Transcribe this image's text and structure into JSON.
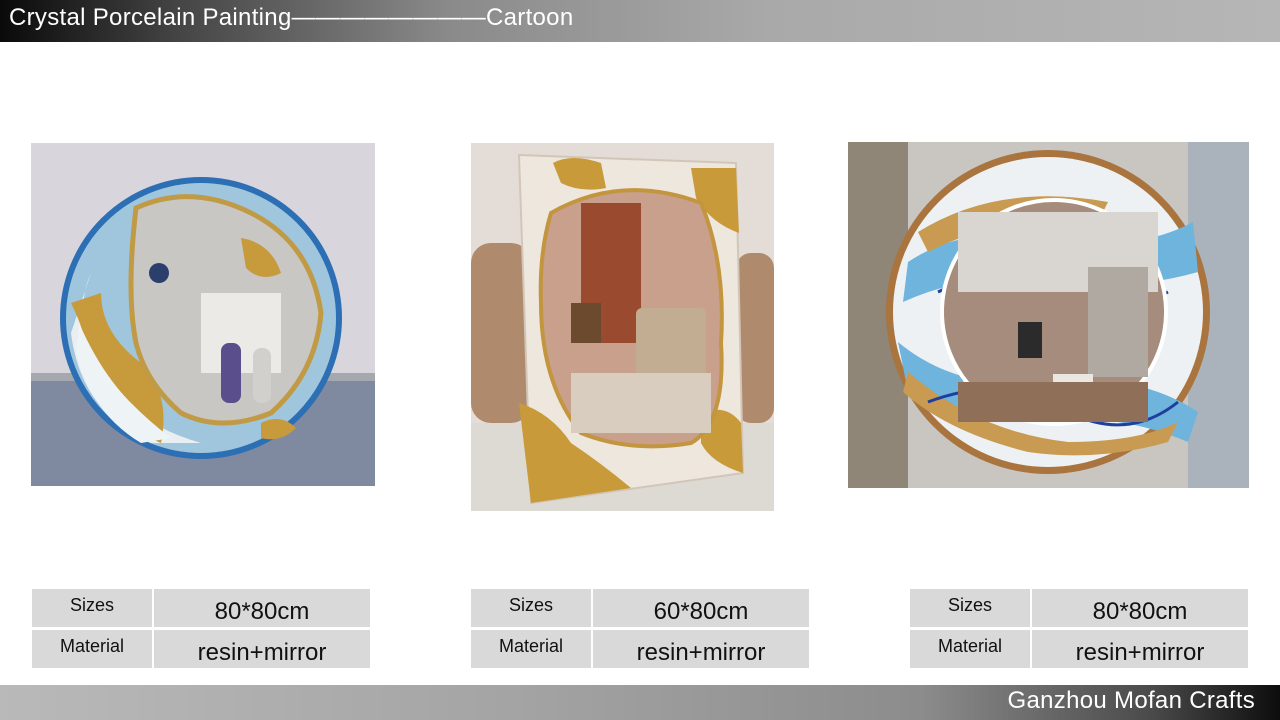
{
  "header": {
    "title": "Crystal Porcelain Painting————————Cartoon"
  },
  "footer": {
    "company": "Ganzhou Mofan Crafts"
  },
  "products": [
    {
      "sizes_label": "Sizes",
      "sizes_value": "80*80cm",
      "material_label": "Material",
      "material_value": "resin+mirror"
    },
    {
      "sizes_label": "Sizes",
      "sizes_value": "60*80cm",
      "material_label": "Material",
      "material_value": "resin+mirror"
    },
    {
      "sizes_label": "Sizes",
      "sizes_value": "80*80cm",
      "material_label": "Material",
      "material_value": "resin+mirror"
    }
  ]
}
